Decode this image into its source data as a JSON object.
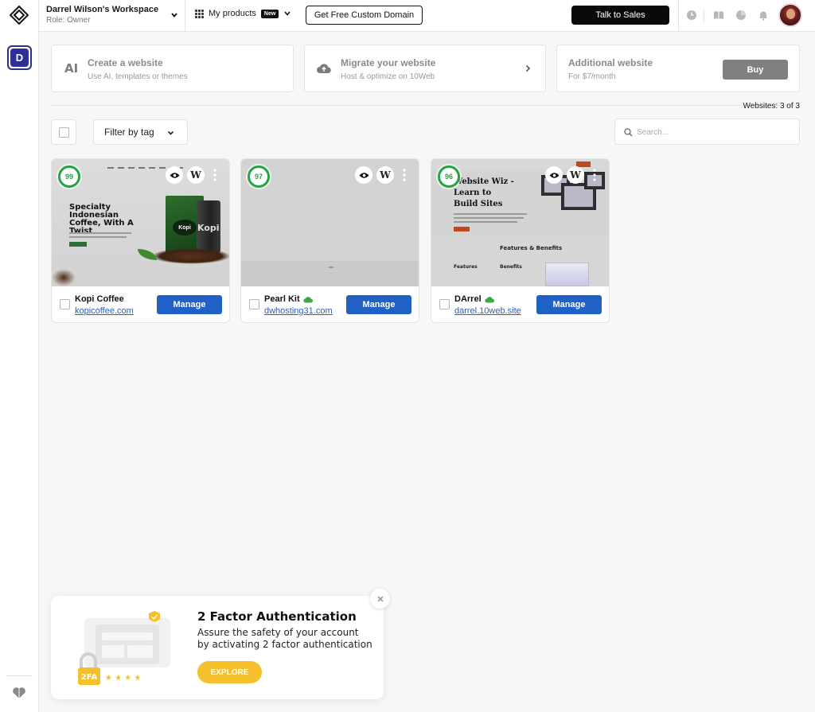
{
  "workspace": {
    "name": "Darrel Wilson's Workspace",
    "role": "Role: Owner",
    "avatar_letter": "D"
  },
  "topbar": {
    "products_label": "My products",
    "new_badge": "New",
    "domain_button": "Get Free Custom Domain",
    "sales_button": "Talk to Sales",
    "icons": [
      "clock-icon",
      "book-icon",
      "pie-chart-icon",
      "bell-icon"
    ]
  },
  "promos": [
    {
      "icon": "AI",
      "title": "Create a website",
      "subtitle": "Use AI, templates or themes"
    },
    {
      "icon": "cloud-upload-icon",
      "title": "Migrate your website",
      "subtitle": "Host & optimize on 10Web"
    },
    {
      "title": "Additional website",
      "subtitle": "For $7/month",
      "button": "Buy"
    }
  ],
  "websites_count": "Websites: 3 of 3",
  "filter": {
    "label": "Filter by tag",
    "search_placeholder": "Search..."
  },
  "sites": [
    {
      "score": "99",
      "name": "Kopi Coffee",
      "domain": "kopicoffee.com",
      "manage": "Manage",
      "hosted_badge": false,
      "thumb": {
        "headline": "Specialty Indonesian Coffee, With A Twist",
        "bag_label": "Kopi",
        "cup_label": "Kopi"
      }
    },
    {
      "score": "97",
      "name": "Pearl Kit",
      "domain": "dwhosting31.com",
      "manage": "Manage",
      "hosted_badge": true
    },
    {
      "score": "96",
      "name": "DArrel",
      "domain": "darrel.10web.site",
      "manage": "Manage",
      "hosted_badge": true,
      "thumb": {
        "headline": "Website Wiz - Learn to Build Sites",
        "section_title": "Features & Benefits",
        "col1": "Features",
        "col2": "Benefits"
      }
    }
  ],
  "toast": {
    "title": "2 Factor Authentication",
    "body": "Assure the safety of your account by activating 2 factor authentication",
    "button": "EXPLORE",
    "badge": "2FA",
    "stars": "★ ★ ★ ★"
  },
  "colors": {
    "accent_blue": "#2160c4",
    "score_green": "#25a443",
    "explore_yellow": "#f6bf2c",
    "workspace_purple": "#2c2f9a"
  }
}
